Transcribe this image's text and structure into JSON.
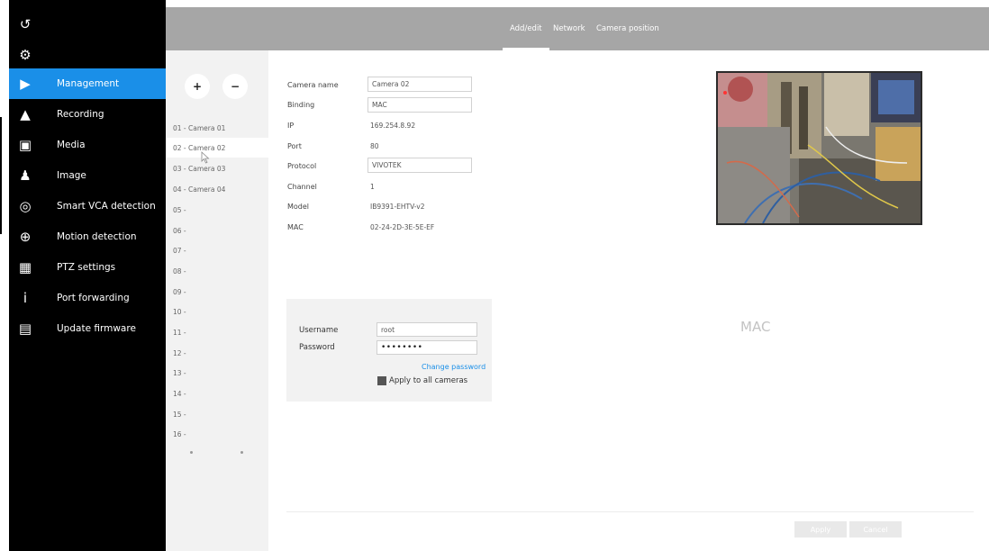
{
  "icon_rail": [
    {
      "icon": "back-icon",
      "glyph": "↺"
    },
    {
      "icon": "gear-icon",
      "glyph": "⚙"
    },
    {
      "icon": "camera-icon",
      "glyph": "▶"
    },
    {
      "icon": "alert-icon",
      "glyph": "▲"
    },
    {
      "icon": "media-icon",
      "glyph": "▣"
    },
    {
      "icon": "person-icon",
      "glyph": "♟"
    },
    {
      "icon": "storage-icon",
      "glyph": "◎"
    },
    {
      "icon": "globe-icon",
      "glyph": "⊕"
    },
    {
      "icon": "grid-icon",
      "glyph": "▦"
    },
    {
      "icon": "info-icon",
      "glyph": "i"
    },
    {
      "icon": "firmware-icon",
      "glyph": "▤"
    }
  ],
  "menu": [
    {
      "label": "Management",
      "active": true
    },
    {
      "label": "Recording"
    },
    {
      "label": "Media"
    },
    {
      "label": "Image"
    },
    {
      "label": "Smart VCA detection"
    },
    {
      "label": "Motion detection"
    },
    {
      "label": "PTZ settings"
    },
    {
      "label": "Port forwarding"
    },
    {
      "label": "Update firmware"
    }
  ],
  "tabs": [
    {
      "label": "Add/edit",
      "active": true
    },
    {
      "label": "Network"
    },
    {
      "label": "Camera position"
    }
  ],
  "camera_list": {
    "add_label": "+",
    "remove_label": "−",
    "items": [
      "01 - Camera 01",
      "02 - Camera 02",
      "03 - Camera 03",
      "04 - Camera 04",
      "05 -",
      "06 -",
      "07 -",
      "08 -",
      "09 -",
      "10 -",
      "11 -",
      "12 -",
      "13 -",
      "14 -",
      "15 -",
      "16 -"
    ],
    "selected_index": 1
  },
  "camera_form": {
    "camera_name": {
      "label": "Camera name",
      "value": "Camera 02"
    },
    "binding": {
      "label": "Binding",
      "value": "MAC"
    },
    "ip": {
      "label": "IP",
      "value": "169.254.8.92"
    },
    "port": {
      "label": "Port",
      "value": "80"
    },
    "protocol": {
      "label": "Protocol",
      "value": "VIVOTEK"
    },
    "channel": {
      "label": "Channel",
      "value": "1"
    },
    "model": {
      "label": "Model",
      "value": "IB9391-EHTV-v2"
    },
    "mac": {
      "label": "MAC",
      "value": "02-24-2D-3E-5E-EF"
    }
  },
  "auth": {
    "username_label": "Username",
    "username_value": "root",
    "password_label": "Password",
    "password_value": "••••••••",
    "change_password_label": "Change password",
    "apply_all_label": "Apply to all cameras"
  },
  "binding_indicator": "MAC",
  "footer": {
    "apply_label": "Apply",
    "cancel_label": "Cancel"
  },
  "colors": {
    "accent": "#1a8fe8",
    "header": "#a6a6a6",
    "sidebar": "#000000",
    "panel": "#f2f2f2"
  }
}
